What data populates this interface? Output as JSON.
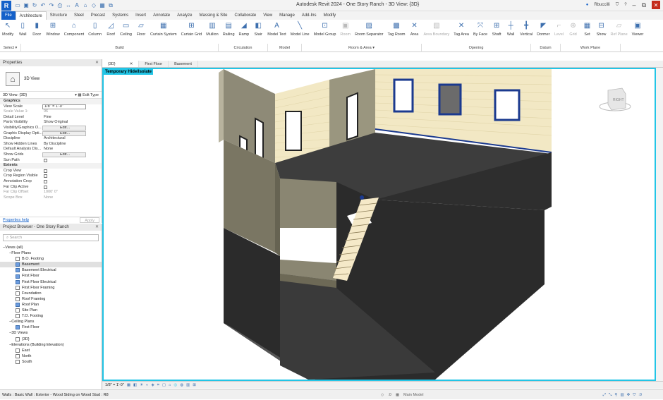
{
  "window": {
    "title": "Autodesk Revit 2024 - One Story Ranch - 3D View: {3D}",
    "user": "Rbuccilli",
    "logo_letter": "R"
  },
  "ribbon_tabs": [
    "File",
    "Architecture",
    "Structure",
    "Steel",
    "Precast",
    "Systems",
    "Insert",
    "Annotate",
    "Analyze",
    "Massing & Site",
    "Collaborate",
    "View",
    "Manage",
    "Add-Ins",
    "Modify"
  ],
  "ribbon_tools": [
    {
      "label": "Modify",
      "icon": "↖",
      "disabled": false
    },
    {
      "label": "Wall",
      "icon": "▯",
      "disabled": false
    },
    {
      "label": "Door",
      "icon": "▮",
      "disabled": false
    },
    {
      "label": "Window",
      "icon": "⊞",
      "disabled": false
    },
    {
      "label": "Component",
      "icon": "⌂",
      "disabled": false
    },
    {
      "label": "Column",
      "icon": "▯",
      "disabled": false
    },
    {
      "label": "Roof",
      "icon": "◿",
      "disabled": false
    },
    {
      "label": "Ceiling",
      "icon": "▭",
      "disabled": false
    },
    {
      "label": "Floor",
      "icon": "▱",
      "disabled": false
    },
    {
      "label": "Curtain System",
      "icon": "▦",
      "disabled": false
    },
    {
      "label": "Curtain Grid",
      "icon": "⊞",
      "disabled": false
    },
    {
      "label": "Mullion",
      "icon": "▥",
      "disabled": false
    },
    {
      "label": "Railing",
      "icon": "▤",
      "disabled": false
    },
    {
      "label": "Ramp",
      "icon": "◢",
      "disabled": false
    },
    {
      "label": "Stair",
      "icon": "◧",
      "disabled": false
    },
    {
      "label": "Model Text",
      "icon": "A",
      "disabled": false
    },
    {
      "label": "Model Line",
      "icon": "╲",
      "disabled": false
    },
    {
      "label": "Model Group",
      "icon": "⊡",
      "disabled": false
    },
    {
      "label": "Room",
      "icon": "▣",
      "disabled": true
    },
    {
      "label": "Room Separator",
      "icon": "▨",
      "disabled": false
    },
    {
      "label": "Tag Room",
      "icon": "▩",
      "disabled": false
    },
    {
      "label": "Area",
      "icon": "✕",
      "disabled": false
    },
    {
      "label": "Area Boundary",
      "icon": "▧",
      "disabled": true
    },
    {
      "label": "Tag Area",
      "icon": "✕",
      "disabled": false
    },
    {
      "label": "By Face",
      "icon": "⤧",
      "disabled": false
    },
    {
      "label": "Shaft",
      "icon": "⊞",
      "disabled": false
    },
    {
      "label": "Wall",
      "icon": "┼",
      "disabled": false
    },
    {
      "label": "Vertical",
      "icon": "╋",
      "disabled": false
    },
    {
      "label": "Dormer",
      "icon": "◤",
      "disabled": false
    },
    {
      "label": "Level",
      "icon": "⌐",
      "disabled": true
    },
    {
      "label": "Grid",
      "icon": "⊕",
      "disabled": true
    },
    {
      "label": "Set",
      "icon": "▦",
      "disabled": false
    },
    {
      "label": "Show",
      "icon": "⊟",
      "disabled": false
    },
    {
      "label": "Ref Plane",
      "icon": "▱",
      "disabled": true
    },
    {
      "label": "Viewer",
      "icon": "▣",
      "disabled": false
    }
  ],
  "ribbon_groups": [
    "Select ▾",
    "Build",
    "Circulation",
    "Model",
    "Room & Area ▾",
    "Opening",
    "Datum",
    "Work Plane"
  ],
  "properties": {
    "header": "Properties",
    "type_name": "3D View",
    "instance": "3D View: {3D}",
    "edit_type": "Edit Type",
    "rows": [
      {
        "k": "Graphics",
        "v": "",
        "cat": true
      },
      {
        "k": "View Scale",
        "v": "1/8\" = 1'-0\"",
        "style": "box"
      },
      {
        "k": "Scale Value 1:",
        "v": "96",
        "dim": true
      },
      {
        "k": "Detail Level",
        "v": "Fine"
      },
      {
        "k": "Parts Visibility",
        "v": "Show Original"
      },
      {
        "k": "Visibility/Graphics O...",
        "v": "Edit...",
        "style": "btn"
      },
      {
        "k": "Graphic Display Opti...",
        "v": "Edit...",
        "style": "btn"
      },
      {
        "k": "Discipline",
        "v": "Architectural"
      },
      {
        "k": "Show Hidden Lines",
        "v": "By Discipline"
      },
      {
        "k": "Default Analysis Dis...",
        "v": "None"
      },
      {
        "k": "Show Grids",
        "v": "Edit...",
        "style": "btn"
      },
      {
        "k": "Sun Path",
        "v": "",
        "check": true
      },
      {
        "k": "Extents",
        "v": "",
        "cat": true
      },
      {
        "k": "Crop View",
        "v": "",
        "check": true
      },
      {
        "k": "Crop Region Visible",
        "v": "",
        "check": true
      },
      {
        "k": "Annotation Crop",
        "v": "",
        "check": true
      },
      {
        "k": "Far Clip Active",
        "v": "",
        "check": true
      },
      {
        "k": "Far Clip Offset",
        "v": "1000' 0\"",
        "dim": true
      },
      {
        "k": "Scope Box",
        "v": "None",
        "dim": true
      }
    ],
    "help": "Properties help",
    "apply": "Apply"
  },
  "browser": {
    "header": "Project Browser - One Story Ranch",
    "search_placeholder": "Search",
    "items": [
      {
        "label": "Views (all)",
        "indent": 0,
        "kind": "group"
      },
      {
        "label": "Floor Plans",
        "indent": 1,
        "kind": "group"
      },
      {
        "label": "B.O. Footing",
        "indent": 2,
        "kind": "view"
      },
      {
        "label": "Basement",
        "indent": 2,
        "kind": "view-blue",
        "sel": true
      },
      {
        "label": "Basement Electrical",
        "indent": 2,
        "kind": "view-blue"
      },
      {
        "label": "First Floor",
        "indent": 2,
        "kind": "view-blue"
      },
      {
        "label": "First Floor Electrical",
        "indent": 2,
        "kind": "view-blue"
      },
      {
        "label": "First Floor Framing",
        "indent": 2,
        "kind": "view"
      },
      {
        "label": "Foundation",
        "indent": 2,
        "kind": "view"
      },
      {
        "label": "Roof Framing",
        "indent": 2,
        "kind": "view"
      },
      {
        "label": "Roof Plan",
        "indent": 2,
        "kind": "view-blue"
      },
      {
        "label": "Site Plan",
        "indent": 2,
        "kind": "view"
      },
      {
        "label": "T.O. Footing",
        "indent": 2,
        "kind": "view"
      },
      {
        "label": "Ceiling Plans",
        "indent": 1,
        "kind": "group"
      },
      {
        "label": "First Floor",
        "indent": 2,
        "kind": "view-blue"
      },
      {
        "label": "3D Views",
        "indent": 1,
        "kind": "group"
      },
      {
        "label": "{3D}",
        "indent": 2,
        "kind": "view"
      },
      {
        "label": "Elevations (Building Elevation)",
        "indent": 1,
        "kind": "group"
      },
      {
        "label": "East",
        "indent": 2,
        "kind": "view"
      },
      {
        "label": "North",
        "indent": 2,
        "kind": "view"
      },
      {
        "label": "South",
        "indent": 2,
        "kind": "view"
      }
    ]
  },
  "view_tabs": [
    {
      "label": "{3D}",
      "active": true
    },
    {
      "label": "First Floor",
      "active": false
    },
    {
      "label": "Basement",
      "active": false
    }
  ],
  "viewport": {
    "banner": "Temporary Hide/Isolate",
    "viewcube_label": "RIGHT"
  },
  "view_control": {
    "scale": "1/8\" = 1'-0\""
  },
  "status": {
    "text": "Walls : Basic Wall : Exterior - Wood Siding on Wood Stud : R8",
    "count": ":0",
    "model": "Main Model",
    "filter": ":0"
  },
  "colors": {
    "accent": "#1561c9",
    "isolate": "#22c5e6",
    "siding": "#f2e8c4",
    "wall_dark": "#3a3a3a",
    "wall_tan": "#8a8672"
  }
}
